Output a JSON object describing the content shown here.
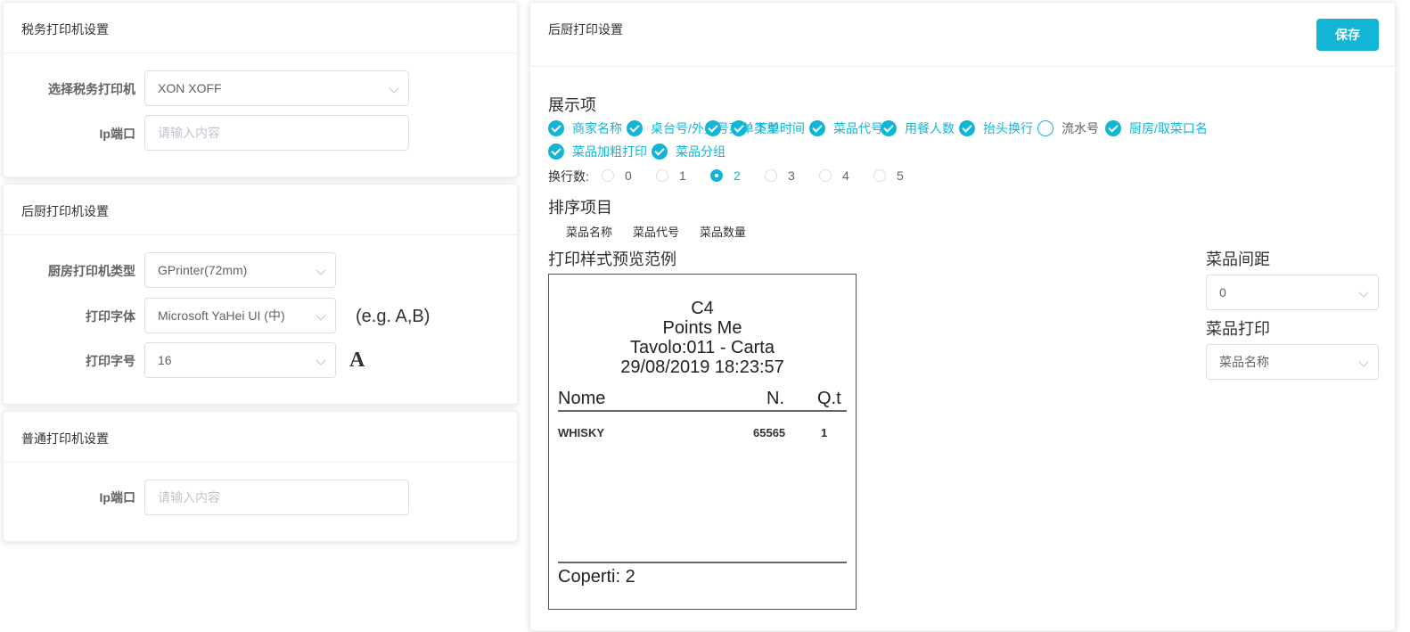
{
  "tax_printer": {
    "title": "税务打印机设置",
    "select_label": "选择税务打印机",
    "select_value": "XON XOFF",
    "ip_label": "Ip端口",
    "ip_placeholder": "请输入内容"
  },
  "kitchen_printer": {
    "title": "后厨打印机设置",
    "type_label": "厨房打印机类型",
    "type_value": "GPrinter(72mm)",
    "font_label": "打印字体",
    "font_value": "Microsoft YaHei UI (中)",
    "font_example": "(e.g. A,B)",
    "size_label": "打印字号",
    "size_value": "16",
    "size_sample": "A"
  },
  "normal_printer": {
    "title": "普通打印机设置",
    "ip_label": "Ip端口",
    "ip_placeholder": "请输入内容"
  },
  "kitchen_print_settings": {
    "title": "后厨打印设置",
    "save_label": "保存",
    "display_title": "展示项",
    "display_items": [
      {
        "label": "商家名称",
        "checked": true
      },
      {
        "label": "桌台号/外卖号",
        "checked": true
      },
      {
        "label": "菜单类型",
        "checked": true
      },
      {
        "label": "下单时间",
        "checked": true
      },
      {
        "label": "菜品代号",
        "checked": true
      },
      {
        "label": "用餐人数",
        "checked": true
      },
      {
        "label": "抬头换行",
        "checked": true
      },
      {
        "label": "流水号",
        "checked": false
      },
      {
        "label": "厨房/取菜口名",
        "checked": true
      },
      {
        "label": "菜品加粗打印",
        "checked": true
      },
      {
        "label": "菜品分组",
        "checked": true
      }
    ],
    "line_count_label": "换行数:",
    "line_count_options": [
      "0",
      "1",
      "2",
      "3",
      "4",
      "5"
    ],
    "line_count_selected": "2",
    "sort_title": "排序项目",
    "sort_items": [
      "菜品名称",
      "菜品代号",
      "菜品数量"
    ],
    "preview_title": "打印样式预览范例",
    "spacing_label": "菜品间距",
    "spacing_value": "0",
    "item_print_label": "菜品打印",
    "item_print_value": "菜品名称"
  },
  "receipt": {
    "line1": "C4",
    "line2": "Points Me",
    "line3": "Tavolo:011 - Carta",
    "line4": "29/08/2019 18:23:57",
    "col_name": "Nome",
    "col_num": "N.",
    "col_qty": "Q.t",
    "item_name": "WHISKY",
    "item_code": "65565",
    "item_qty": "1",
    "footer": "Coperti: 2"
  },
  "colors": {
    "accent": "#12b5d6",
    "text": "#303133",
    "muted": "#606266",
    "placeholder": "#c0c4cc",
    "border": "#dcdfe6"
  }
}
